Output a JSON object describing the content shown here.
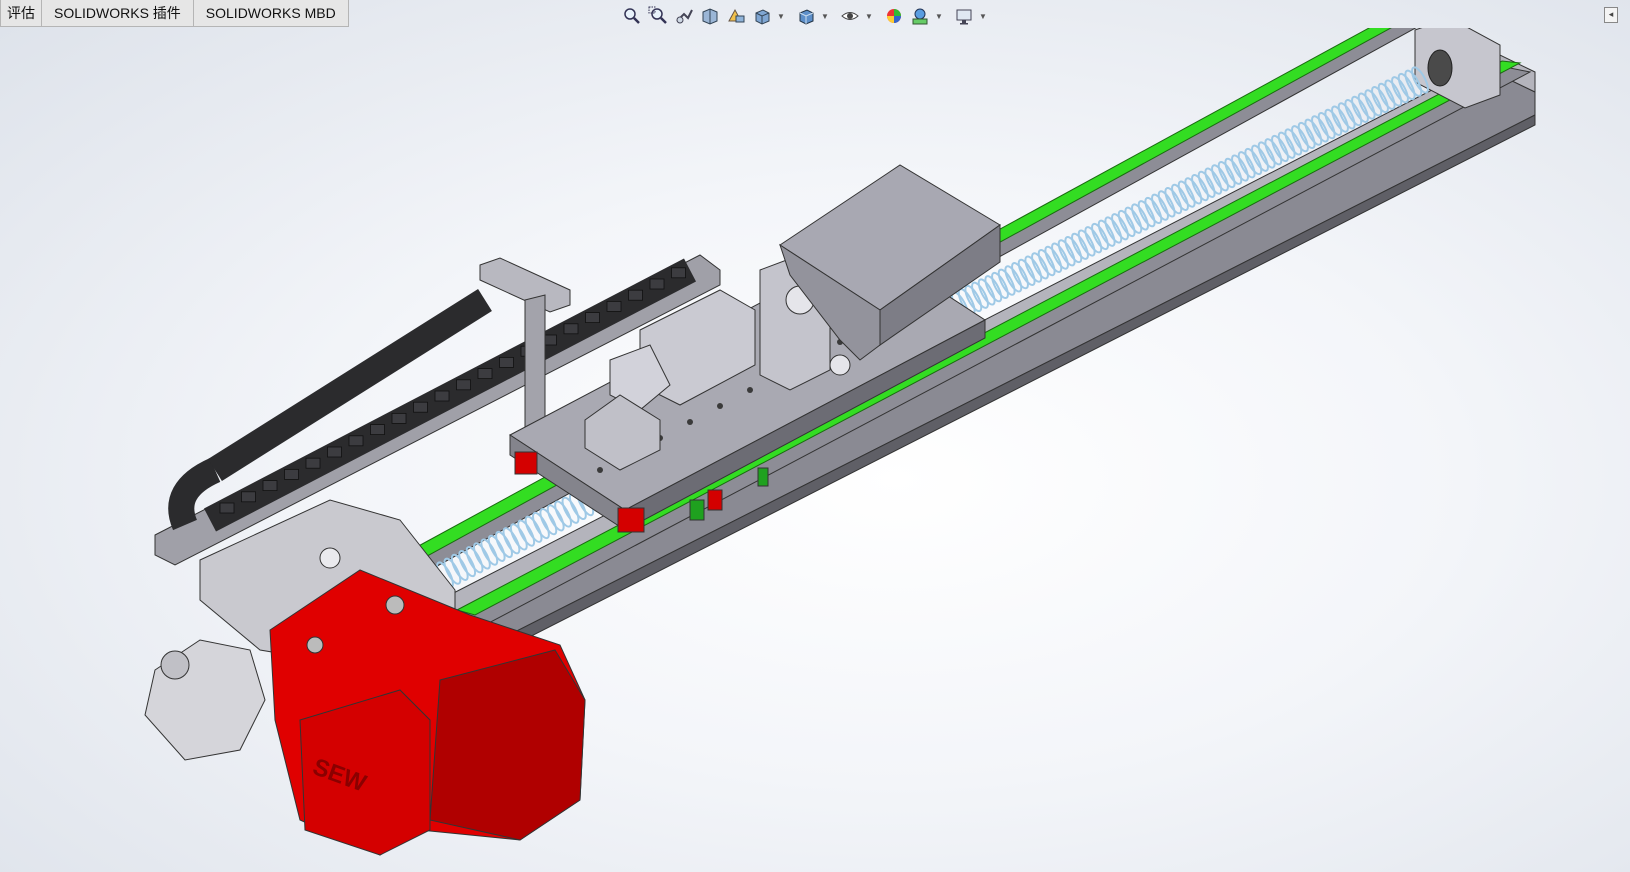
{
  "tabs": [
    "评估",
    "SOLIDWORKS 插件",
    "SOLIDWORKS MBD"
  ],
  "heads_up_toolbar": {
    "icons": [
      "zoom-to-fit-icon",
      "zoom-to-area-icon",
      "previous-view-icon",
      "section-view-icon",
      "dynamic-annotation-icon",
      "view-orientation-icon",
      "display-style-icon",
      "hide-show-items-icon",
      "edit-appearance-icon",
      "apply-scene-icon",
      "view-settings-icon"
    ]
  },
  "model": {
    "motor_brand": "SEW",
    "colors": {
      "motor": "#e00000",
      "rail_accent": "#33dd22",
      "frame": "#8a8a93",
      "carriage": "#a9a9b2",
      "spring": "#9fc9e6",
      "cable_chain": "#2b2b2d",
      "block_red": "#d40000",
      "block_green": "#1fa11f"
    }
  }
}
